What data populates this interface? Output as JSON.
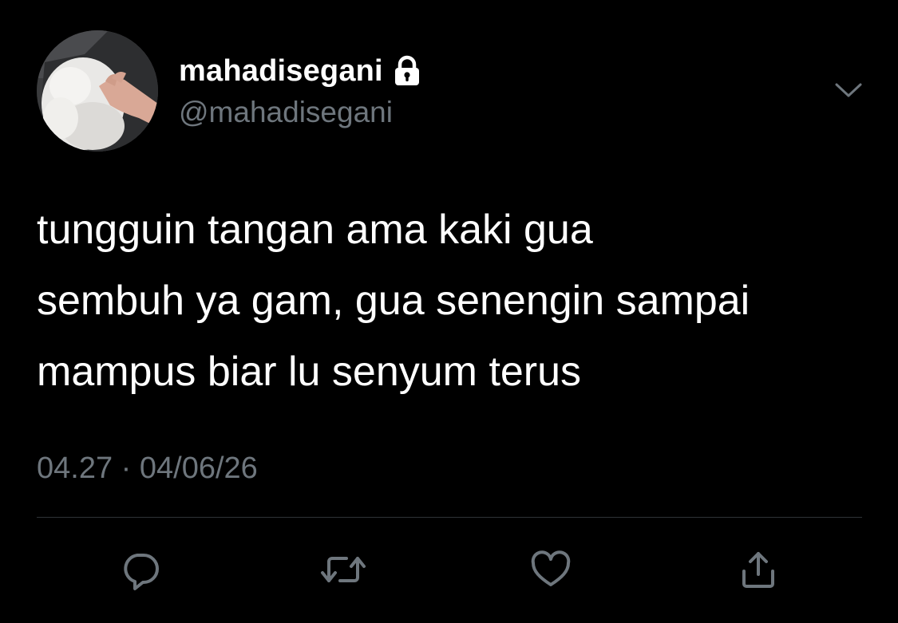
{
  "profile": {
    "display_name": "mahadisegani",
    "handle": "@mahadisegani",
    "protected_icon": "lock-icon",
    "avatar": "avatar-photo-white-dog"
  },
  "tweet": {
    "text_lines": [
      "tungguin tangan ama kaki gua",
      "sembuh ya gam, gua senengin sampai",
      "mampus biar lu senyum terus"
    ],
    "time": "04.27",
    "separator": "·",
    "date": "04/06/26"
  },
  "actions": {
    "reply_icon": "reply-icon",
    "retweet_icon": "retweet-icon",
    "like_icon": "heart-icon",
    "share_icon": "share-icon",
    "menu_icon": "chevron-down-icon"
  },
  "colors": {
    "background": "#000000",
    "text": "#ffffff",
    "secondary": "#6e767d",
    "divider": "#2f3336"
  }
}
